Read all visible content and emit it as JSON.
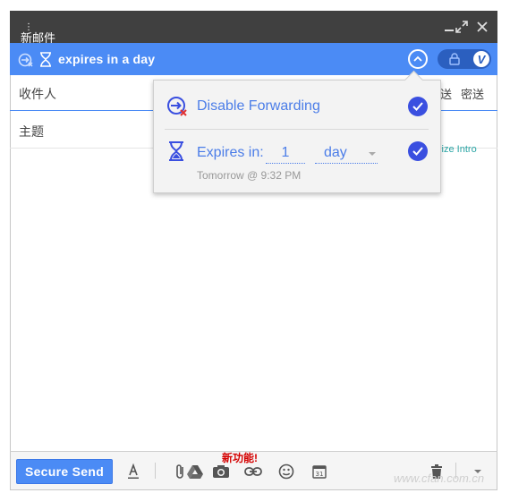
{
  "window": {
    "title": "新邮件",
    "dots": "⋮",
    "minimize_label": "_",
    "expand_label": "⤢",
    "close_label": "✕"
  },
  "securebar": {
    "label": "expires in a day"
  },
  "fields": {
    "to_label": "收件人",
    "cc_label": "送",
    "bcc_label": "密送",
    "subject_label": "主题"
  },
  "body": {
    "personalize_link": "alize Intro"
  },
  "popup": {
    "disable_forwarding": "Disable Forwarding",
    "expires_label": "Expires in:",
    "expires_value": "1",
    "expires_unit": "day",
    "expires_sub": "Tomorrow @ 9:32 PM"
  },
  "toolbar": {
    "send_label": "Secure Send",
    "new_feature": "新功能!",
    "watermark": "www.cfan.com.cn"
  },
  "colors": {
    "accent": "#4b8bf5",
    "check": "#3a4fe0",
    "titlebar": "#404040"
  }
}
